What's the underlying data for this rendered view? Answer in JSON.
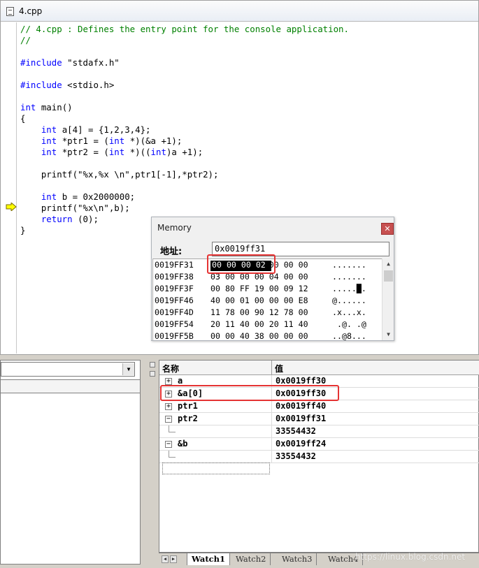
{
  "editor": {
    "file_tab": "4.cpp",
    "code": [
      [
        {
          "t": "// 4.cpp : Defines the entry point for the console application.",
          "c": "cm"
        }
      ],
      [
        {
          "t": "//",
          "c": "cm"
        }
      ],
      [],
      [
        {
          "t": "#include",
          "c": "kw"
        },
        {
          "t": " \"stdafx.h\""
        }
      ],
      [],
      [
        {
          "t": "#include",
          "c": "kw"
        },
        {
          "t": " <stdio.h>"
        }
      ],
      [],
      [
        {
          "t": "int",
          "c": "kw"
        },
        {
          "t": " main()"
        }
      ],
      [
        {
          "t": "{"
        }
      ],
      [
        {
          "t": "    "
        },
        {
          "t": "int",
          "c": "kw"
        },
        {
          "t": " a[4] = {1,2,3,4};"
        }
      ],
      [
        {
          "t": "    "
        },
        {
          "t": "int",
          "c": "kw"
        },
        {
          "t": " *ptr1 = ("
        },
        {
          "t": "int",
          "c": "kw"
        },
        {
          "t": " *)(&a +1);"
        }
      ],
      [
        {
          "t": "    "
        },
        {
          "t": "int",
          "c": "kw"
        },
        {
          "t": " *ptr2 = ("
        },
        {
          "t": "int",
          "c": "kw"
        },
        {
          "t": " *)(("
        },
        {
          "t": "int",
          "c": "kw"
        },
        {
          "t": ")a +1);"
        }
      ],
      [],
      [
        {
          "t": "    printf(\"%x,%x \\n\",ptr1[-1],*ptr2);"
        }
      ],
      [],
      [
        {
          "t": "    "
        },
        {
          "t": "int",
          "c": "kw"
        },
        {
          "t": " b = 0x2000000;"
        }
      ],
      [
        {
          "t": "    printf(\"%x\\n\",b);"
        }
      ],
      [
        {
          "t": "    "
        },
        {
          "t": "return",
          "c": "kw"
        },
        {
          "t": " (0);"
        }
      ],
      [
        {
          "t": "}"
        }
      ]
    ]
  },
  "memory": {
    "title": "Memory",
    "close_icon": "✕",
    "address_label": "地址:",
    "address_value": "0x0019ff31",
    "highlight_bytes": "00 00 00 02",
    "rows": [
      {
        "addr": "0019FF31",
        "bytes": "            00 00 00",
        "ascii": "......."
      },
      {
        "addr": "0019FF38",
        "bytes": "03 00 00 00 04 00 00",
        "ascii": "......."
      },
      {
        "addr": "0019FF3F",
        "bytes": "00 80 FF 19 00 09 12",
        "ascii": ".....█."
      },
      {
        "addr": "0019FF46",
        "bytes": "40 00 01 00 00 00 E8",
        "ascii": "@......"
      },
      {
        "addr": "0019FF4D",
        "bytes": "11 78 00 90 12 78 00",
        "ascii": ".x...x."
      },
      {
        "addr": "0019FF54",
        "bytes": "20 11 40 00 20 11 40",
        "ascii": " .@. .@"
      },
      {
        "addr": "0019FF5B",
        "bytes": "00 00 40 38 00 00 00",
        "ascii": "..@8..."
      }
    ]
  },
  "watch": {
    "col_name": "名称",
    "col_value": "值",
    "rows": [
      {
        "toggle": "+",
        "name": "a",
        "value": "0x0019ff30",
        "child": false
      },
      {
        "toggle": "+",
        "name": "&a[0]",
        "value": "0x0019ff30",
        "child": false
      },
      {
        "toggle": "+",
        "name": "ptr1",
        "value": "0x0019ff40",
        "child": false
      },
      {
        "toggle": "−",
        "name": "ptr2",
        "value": "0x0019ff31",
        "child": false
      },
      {
        "toggle": "",
        "name": "",
        "value": "33554432",
        "child": true
      },
      {
        "toggle": "−",
        "name": "&b",
        "value": "0x0019ff24",
        "child": false
      },
      {
        "toggle": "",
        "name": "",
        "value": "33554432",
        "child": true
      }
    ],
    "tabs": [
      "Watch1",
      "Watch2",
      "Watch3",
      "Watch4"
    ],
    "active_tab": 0
  },
  "watermark": "https://linux.blog.csdn.net",
  "colors": {
    "keyword": "#0000ff",
    "comment": "#008000",
    "highlight": "#e53333"
  }
}
